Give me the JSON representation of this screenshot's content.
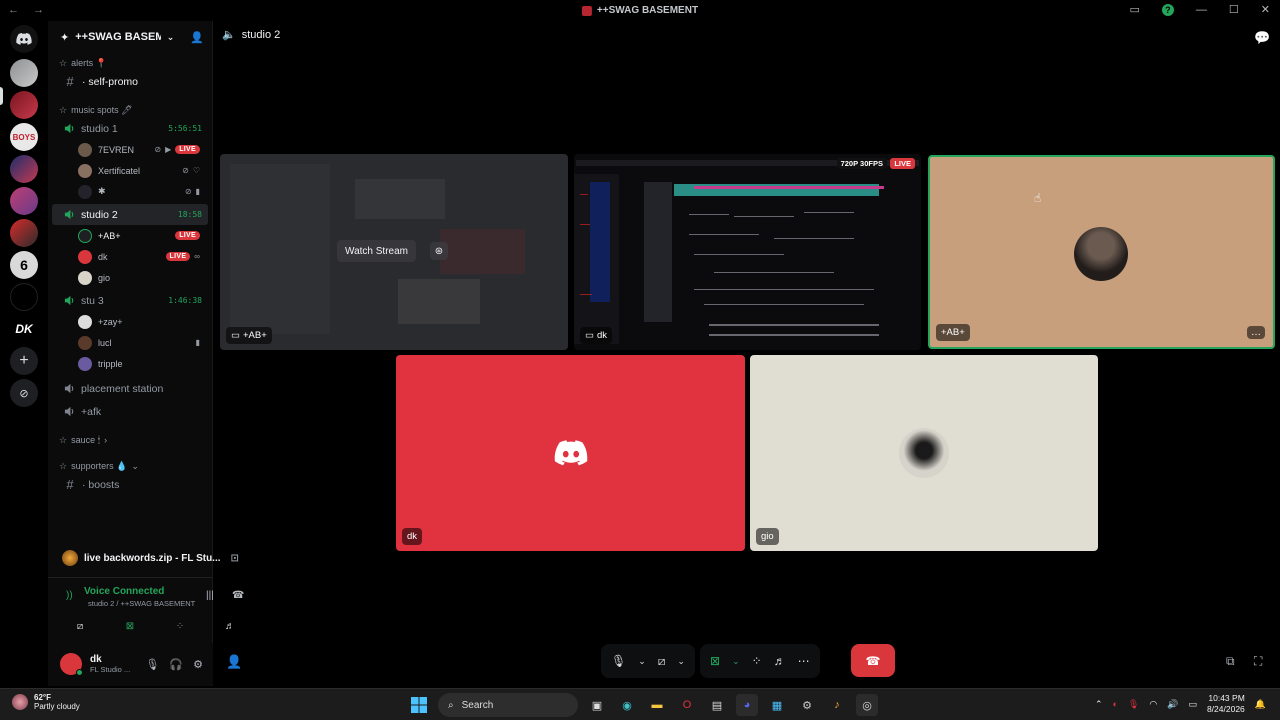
{
  "window": {
    "title": "++SWAG BASEMENT"
  },
  "server": {
    "name": "++SWAG BASEM..."
  },
  "categories": {
    "alerts": "alerts 📍",
    "music": "music spots 🖊",
    "sauce": "sauce 🕯",
    "supporters": "supporters 💧"
  },
  "channels": {
    "self_promo": "· self-promo",
    "studio1": {
      "name": "studio 1",
      "timer": "5:56:51"
    },
    "studio2": {
      "name": "studio 2",
      "timer": "18:58"
    },
    "stu3": {
      "name": "stu 3",
      "timer": "1:46:38"
    },
    "placement": "placement station",
    "afk": "+afk",
    "boosts": "· boosts"
  },
  "studio1_users": [
    {
      "name": "7EVREN",
      "live": "LIVE"
    },
    {
      "name": "Xertificatel"
    },
    {
      "name": "✱"
    }
  ],
  "studio2_users": [
    {
      "name": "+AB+",
      "live": "LIVE"
    },
    {
      "name": "dk",
      "live": "LIVE"
    },
    {
      "name": "gio"
    }
  ],
  "stu3_users": [
    {
      "name": "+zay+"
    },
    {
      "name": "lucl"
    },
    {
      "name": "tripple"
    }
  ],
  "activity": {
    "text": "live backwords.zip - FL Stu..."
  },
  "voice": {
    "status": "Voice Connected",
    "location": "studio 2 / ++SWAG BASEMENT"
  },
  "me": {
    "name": "dk",
    "status": "FL Studio ..."
  },
  "stage": {
    "channel": "studio 2",
    "watch_label": "Watch Stream",
    "quality": "720P 30FPS",
    "live": "LIVE",
    "tiles": {
      "ab_stream": "+AB+",
      "dk_stream": "dk",
      "ab_cam": "+AB+",
      "dk": "dk",
      "gio": "gio"
    }
  },
  "taskbar": {
    "temp": "62°F",
    "weather": "Partly cloudy",
    "search": "Search",
    "time": "10:43 PM",
    "date": "8/24/2026"
  },
  "colors": {
    "accent": "#23a55a",
    "live": "#da373c",
    "discord_red": "#e0323f",
    "tan": "#c79f7c",
    "cream": "#e0ddd2"
  }
}
